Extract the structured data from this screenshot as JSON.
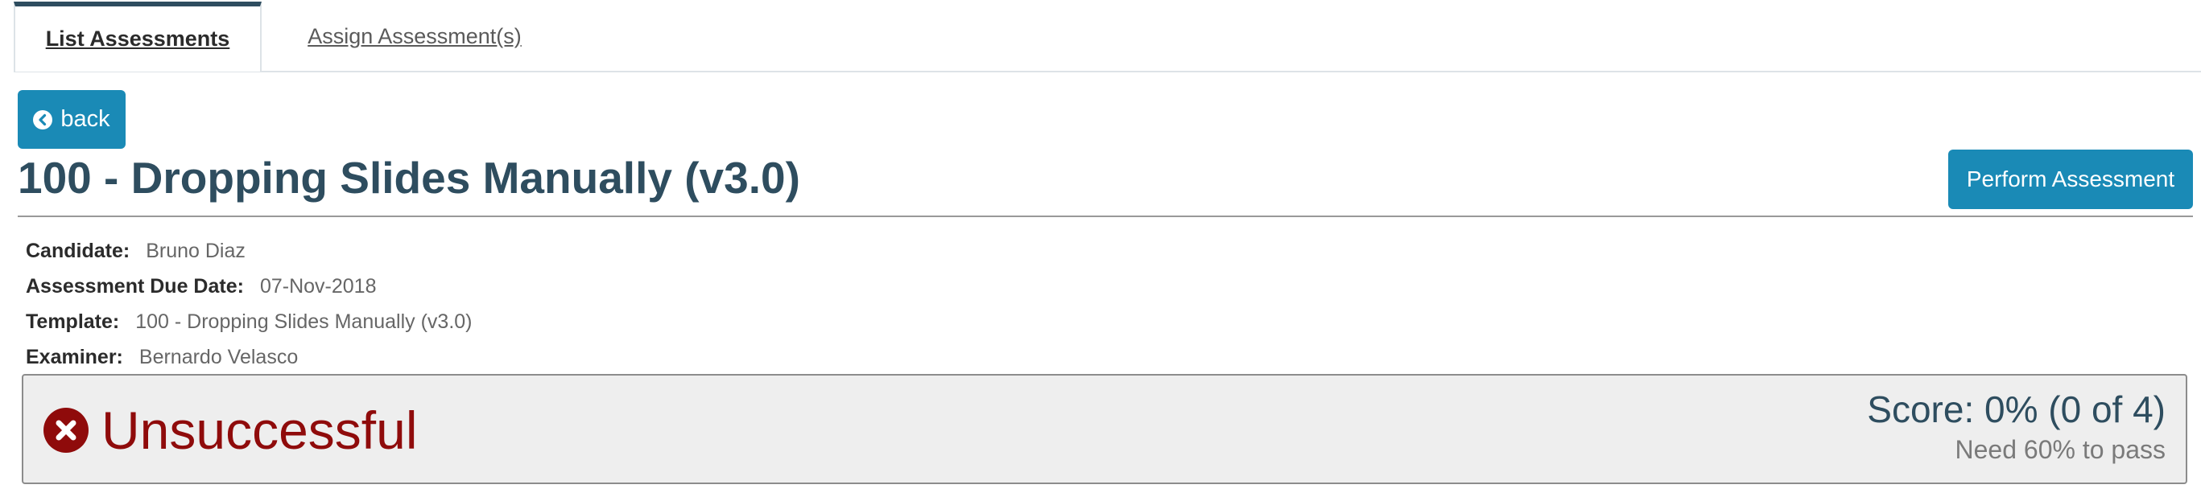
{
  "tabs": [
    {
      "label": "List Assessments",
      "active": true
    },
    {
      "label": "Assign Assessment(s)",
      "active": false
    }
  ],
  "back_button": {
    "label": "back",
    "icon": "chevron-circle-left-icon"
  },
  "title": "100 - Dropping Slides Manually (v3.0)",
  "perform_button": {
    "label": "Perform Assessment"
  },
  "details": {
    "candidate_label": "Candidate:",
    "candidate_value": "Bruno Diaz",
    "due_date_label": "Assessment Due Date:",
    "due_date_value": "07-Nov-2018",
    "template_label": "Template:",
    "template_value": "100 - Dropping Slides Manually (v3.0)",
    "examiner_label": "Examiner:",
    "examiner_value": "Bernardo Velasco"
  },
  "result": {
    "status": "Unsuccessful",
    "status_icon": "times-circle-icon",
    "score": "Score: 0% (0 of 4)",
    "requirement": "Need 60% to pass"
  },
  "colors": {
    "primary_button": "#1a8ab6",
    "heading": "#2e4d5f",
    "failure": "#8f0b0b"
  }
}
